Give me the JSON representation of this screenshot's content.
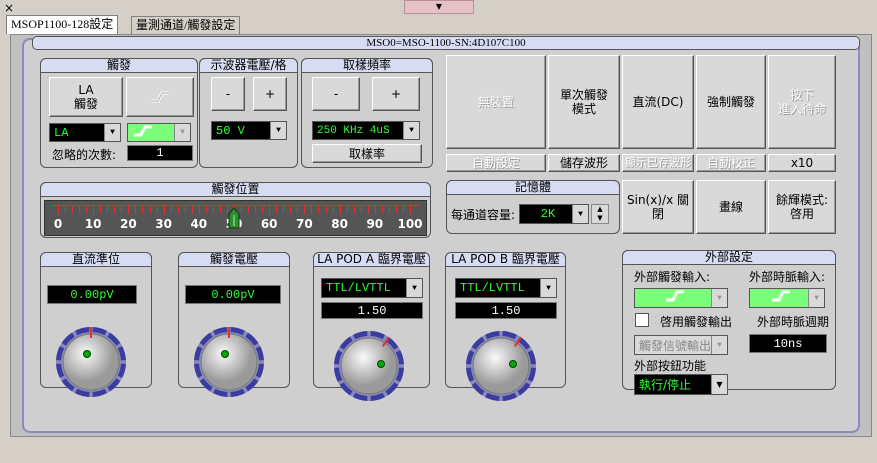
{
  "window": {
    "close_glyph": "×",
    "grip_glyph": "▼"
  },
  "tabs": [
    {
      "label": "MSOP1100-128設定",
      "active": true
    },
    {
      "label": "量測通道/觸發設定",
      "active": false
    }
  ],
  "device_title": "MSO0=MSO-1100-SN:4D107C100",
  "trigger": {
    "title": "觸發",
    "la_button": "LA\n觸發",
    "source_value": "LA",
    "ignore_label": "忽略的次數:",
    "ignore_value": "1"
  },
  "scope_voltage": {
    "title": "示波器電壓/格",
    "minus": "-",
    "plus": "+",
    "value": "50 V"
  },
  "sample": {
    "title": "取樣頻率",
    "minus": "-",
    "plus": "+",
    "value": "250 KHz 4uS",
    "rate_button": "取樣率"
  },
  "actions": {
    "no_device": "無裝置",
    "single_trigger": "單次觸發\n模式",
    "dc": "直流(DC)",
    "force_trigger": "強制觸發",
    "press_enter": "按下\n進入待命",
    "auto_setup": "自動設定",
    "save_wave": "儲存波形",
    "show_saved": "顯示已存波形",
    "auto_cal": "自動校正",
    "x10": "x10",
    "sinx": "Sin(x)/x 關閉",
    "draw_line": "畫線",
    "persist": "餘輝模式:\n啓用"
  },
  "memory": {
    "title": "記憶體",
    "label": "每通道容量:",
    "value": "2K"
  },
  "trigger_position": {
    "title": "觸發位置",
    "ticks": [
      "0",
      "10",
      "20",
      "30",
      "40",
      "50",
      "60",
      "70",
      "80",
      "90",
      "100"
    ],
    "value": 50
  },
  "dc_level": {
    "title": "直流準位",
    "value": "0.00pV"
  },
  "trigger_voltage": {
    "title": "觸發電壓",
    "value": "0.00pV"
  },
  "pod_a": {
    "title": "LA POD A 臨界電壓",
    "standard": "TTL/LVTTL",
    "value": "1.50"
  },
  "pod_b": {
    "title": "LA POD B 臨界電壓",
    "standard": "TTL/LVTTL",
    "value": "1.50"
  },
  "external": {
    "title": "外部設定",
    "trigger_input_label": "外部觸發輸入:",
    "clock_input_label": "外部時脈輸入:",
    "enable_trigger_out": "啓用觸發輸出",
    "clock_period_label": "外部時脈週期",
    "clock_period_value": "10ns",
    "trigger_signal_out": "觸發信號輸出",
    "button_function_label": "外部按鈕功能",
    "button_function_value": "執行/停止"
  },
  "colors": {
    "lcd_green": "#2eff2e",
    "title_bar": "#d8dcf3",
    "knob_dot": "#00aa00"
  }
}
